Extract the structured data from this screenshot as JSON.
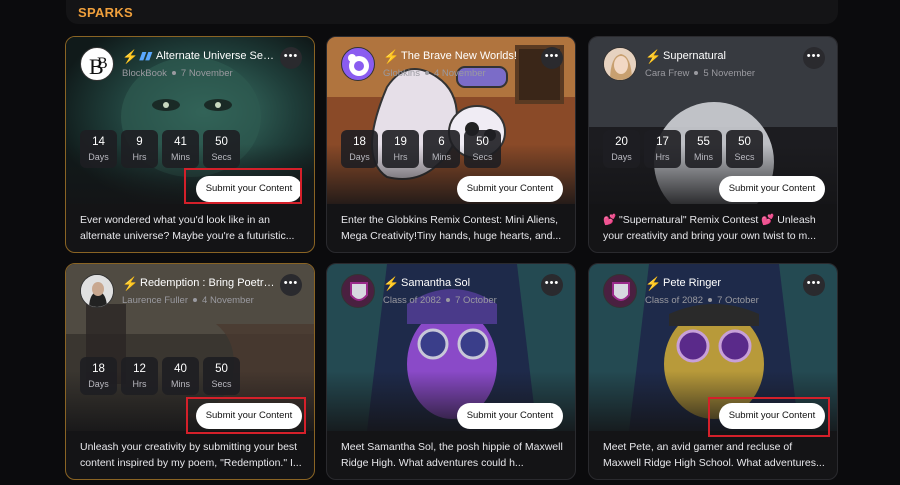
{
  "section": {
    "title": "SPARKS"
  },
  "common": {
    "submit_label": "Submit your Content",
    "more_label": "•••",
    "days_label": "Days",
    "hrs_label": "Hrs",
    "mins_label": "Mins",
    "secs_label": "Secs"
  },
  "cards": [
    {
      "title": "Alternate Universe Self-P...",
      "author": "BlockBook",
      "date": "7 November",
      "countdown": {
        "days": "14",
        "hrs": "9",
        "mins": "41",
        "secs": "50"
      },
      "description": "Ever wondered what you'd look like in an alternate universe? Maybe you're a futuristic...",
      "avatar_text": "B",
      "highlighted": true
    },
    {
      "title": "The Brave New Worlds!",
      "author": "Globkins",
      "date": "4 November",
      "countdown": {
        "days": "18",
        "hrs": "19",
        "mins": "6",
        "secs": "50"
      },
      "description": "Enter the Globkins Remix Contest: Mini Aliens, Mega Creativity!Tiny hands, huge hearts, and...",
      "highlighted": false
    },
    {
      "title": "Supernatural",
      "author": "Cara Frew",
      "date": "5 November",
      "countdown": {
        "days": "20",
        "hrs": "17",
        "mins": "55",
        "secs": "50"
      },
      "description": "💕 \"Supernatural\" Remix Contest 💕 Unleash your creativity and bring your own twist to m...",
      "highlighted": false
    },
    {
      "title": "Redemption : Bring Poetry t...",
      "author": "Laurence Fuller",
      "date": "4 November",
      "countdown": {
        "days": "18",
        "hrs": "12",
        "mins": "40",
        "secs": "50"
      },
      "description": "Unleash your creativity by submitting your best content inspired by my poem, \"Redemption.\" I...",
      "highlighted": true
    },
    {
      "title": "Samantha Sol",
      "author": "Class of 2082",
      "date": "7 October",
      "description": "Meet Samantha Sol, the posh hippie of Maxwell Ridge High. What adventures could h...",
      "highlighted": false
    },
    {
      "title": "Pete Ringer",
      "author": "Class of 2082",
      "date": "7 October",
      "description": "Meet Pete, an avid gamer and recluse of Maxwell Ridge High School. What adventures...",
      "highlighted": true
    }
  ]
}
